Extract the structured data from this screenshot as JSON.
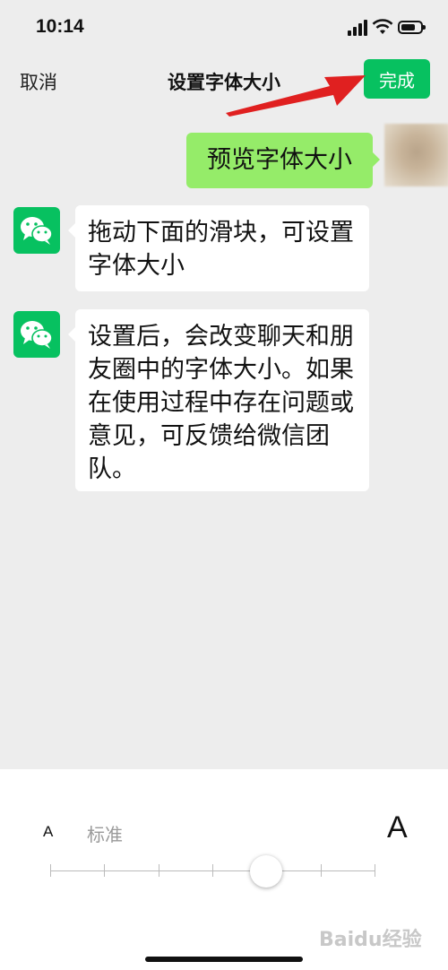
{
  "status_bar": {
    "time": "10:14"
  },
  "nav": {
    "cancel": "取消",
    "title": "设置字体大小",
    "done": "完成"
  },
  "chat": {
    "sent": "预览字体大小",
    "received": [
      "拖动下面的滑块，可设置字体大小",
      "设置后，会改变聊天和朋友圈中的字体大小。如果在使用过程中存在问题或意见，可反馈给微信团队。"
    ]
  },
  "font_slider": {
    "small_label": "A",
    "current_label": "标准",
    "large_label": "A",
    "level_count": 7,
    "selected_level": 5
  },
  "watermark": "Baidu经验",
  "colors": {
    "accent": "#07c160",
    "sent_bubble": "#95ec69",
    "arrow": "#e02020"
  }
}
